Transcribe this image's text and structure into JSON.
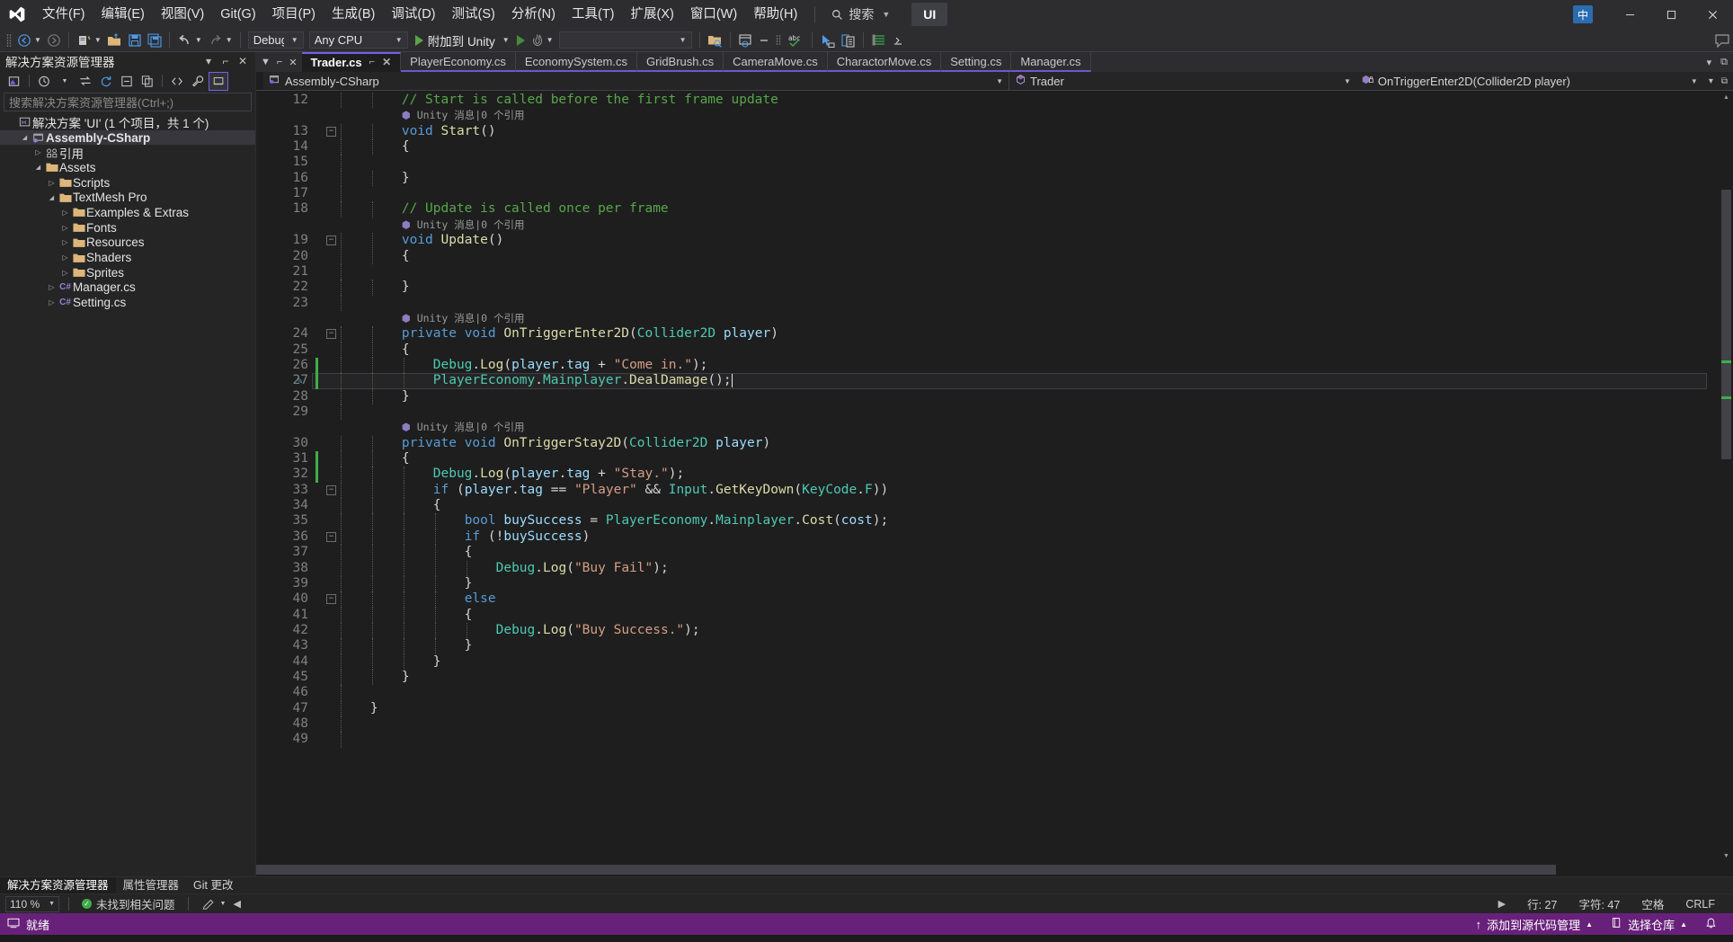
{
  "titlebar": {
    "menus": [
      {
        "label": "文件(F)"
      },
      {
        "label": "编辑(E)"
      },
      {
        "label": "视图(V)"
      },
      {
        "label": "Git(G)"
      },
      {
        "label": "项目(P)"
      },
      {
        "label": "生成(B)"
      },
      {
        "label": "调试(D)"
      },
      {
        "label": "测试(S)"
      },
      {
        "label": "分析(N)"
      },
      {
        "label": "工具(T)"
      },
      {
        "label": "扩展(X)"
      },
      {
        "label": "窗口(W)"
      },
      {
        "label": "帮助(H)"
      }
    ],
    "search_label": "搜索",
    "project_chip": "UI",
    "lang_badge": "中",
    "minimize": "—",
    "maximize": "□",
    "close": "✕"
  },
  "toolbar": {
    "config": "Debug",
    "platform": "Any CPU",
    "run_label": "附加到 Unity",
    "target_combo": ""
  },
  "solution_explorer": {
    "title": "解决方案资源管理器",
    "search_placeholder": "搜索解决方案资源管理器(Ctrl+;)",
    "pin": "⌐",
    "close": "✕",
    "dropdown": "▾",
    "tree": [
      {
        "label": "解决方案 'UI' (1 个项目，共 1 个)",
        "depth": 0,
        "icon": "solution",
        "twist": "",
        "bold": false
      },
      {
        "label": "Assembly-CSharp",
        "depth": 1,
        "icon": "project",
        "twist": "▾",
        "bold": true,
        "selected": true
      },
      {
        "label": "引用",
        "depth": 2,
        "icon": "references",
        "twist": "▸",
        "bold": false
      },
      {
        "label": "Assets",
        "depth": 2,
        "icon": "folder",
        "twist": "▾",
        "bold": false
      },
      {
        "label": "Scripts",
        "depth": 3,
        "icon": "folder",
        "twist": "▸",
        "bold": false
      },
      {
        "label": "TextMesh Pro",
        "depth": 3,
        "icon": "folder",
        "twist": "▾",
        "bold": false
      },
      {
        "label": "Examples & Extras",
        "depth": 4,
        "icon": "folder",
        "twist": "▸",
        "bold": false
      },
      {
        "label": "Fonts",
        "depth": 4,
        "icon": "folder",
        "twist": "▸",
        "bold": false
      },
      {
        "label": "Resources",
        "depth": 4,
        "icon": "folder",
        "twist": "▸",
        "bold": false
      },
      {
        "label": "Shaders",
        "depth": 4,
        "icon": "folder",
        "twist": "▸",
        "bold": false
      },
      {
        "label": "Sprites",
        "depth": 4,
        "icon": "folder",
        "twist": "▸",
        "bold": false
      },
      {
        "label": "Manager.cs",
        "depth": 3,
        "icon": "cs",
        "twist": "▸",
        "bold": false
      },
      {
        "label": "Setting.cs",
        "depth": 3,
        "icon": "cs",
        "twist": "▸",
        "bold": false
      }
    ]
  },
  "editor": {
    "tabs": [
      {
        "label": "Trader.cs",
        "active": true
      },
      {
        "label": "PlayerEconomy.cs",
        "active": false
      },
      {
        "label": "EconomySystem.cs",
        "active": false
      },
      {
        "label": "GridBrush.cs",
        "active": false
      },
      {
        "label": "CameraMove.cs",
        "active": false
      },
      {
        "label": "CharactorMove.cs",
        "active": false
      },
      {
        "label": "Setting.cs",
        "active": false
      },
      {
        "label": "Manager.cs",
        "active": false
      }
    ],
    "nav_project": "Assembly-CSharp",
    "nav_type": "Trader",
    "nav_member": "OnTriggerEnter2D(Collider2D player)",
    "first_line": 12,
    "lines": [
      {
        "n": 12,
        "lens": null,
        "fold": false,
        "change": false,
        "text": "        // Start is called before the first frame update",
        "kind": "comment"
      },
      {
        "n": null,
        "lens": "Unity 消息|0 个引用",
        "lensIndent": "        "
      },
      {
        "n": 13,
        "fold": true,
        "text": "        void Start()"
      },
      {
        "n": 14,
        "text": "        {"
      },
      {
        "n": 15,
        "text": ""
      },
      {
        "n": 16,
        "text": "        }"
      },
      {
        "n": 17,
        "text": ""
      },
      {
        "n": 18,
        "text": "        // Update is called once per frame",
        "kind": "comment"
      },
      {
        "n": null,
        "lens": "Unity 消息|0 个引用",
        "lensIndent": "        "
      },
      {
        "n": 19,
        "fold": true,
        "text": "        void Update()"
      },
      {
        "n": 20,
        "text": "        {"
      },
      {
        "n": 21,
        "text": ""
      },
      {
        "n": 22,
        "text": "        }"
      },
      {
        "n": 23,
        "text": ""
      },
      {
        "n": null,
        "lens": "Unity 消息|0 个引用",
        "lensIndent": "        "
      },
      {
        "n": 24,
        "fold": true,
        "text": "        private void OnTriggerEnter2D(Collider2D player)"
      },
      {
        "n": 25,
        "text": "        {"
      },
      {
        "n": 26,
        "change": true,
        "text": "            Debug.Log(player.tag + \"Come in.\");"
      },
      {
        "n": 27,
        "change": true,
        "current": true,
        "bookmark": true,
        "text": "            PlayerEconomy.Mainplayer.DealDamage();"
      },
      {
        "n": 28,
        "text": "        }"
      },
      {
        "n": 29,
        "text": ""
      },
      {
        "n": null,
        "lens": "Unity 消息|0 个引用",
        "lensIndent": "        "
      },
      {
        "n": 30,
        "fold": false,
        "text": "        private void OnTriggerStay2D(Collider2D player)"
      },
      {
        "n": 31,
        "change": true,
        "text": "        {"
      },
      {
        "n": 32,
        "change": true,
        "text": "            Debug.Log(player.tag + \"Stay.\");"
      },
      {
        "n": 33,
        "fold": true,
        "text": "            if (player.tag == \"Player\" && Input.GetKeyDown(KeyCode.F))"
      },
      {
        "n": 34,
        "text": "            {"
      },
      {
        "n": 35,
        "text": "                bool buySuccess = PlayerEconomy.Mainplayer.Cost(cost);"
      },
      {
        "n": 36,
        "fold": true,
        "text": "                if (!buySuccess)"
      },
      {
        "n": 37,
        "text": "                {"
      },
      {
        "n": 38,
        "text": "                    Debug.Log(\"Buy Fail\");"
      },
      {
        "n": 39,
        "text": "                }"
      },
      {
        "n": 40,
        "fold": true,
        "text": "                else"
      },
      {
        "n": 41,
        "text": "                {"
      },
      {
        "n": 42,
        "text": "                    Debug.Log(\"Buy Success.\");"
      },
      {
        "n": 43,
        "text": "                }"
      },
      {
        "n": 44,
        "text": "            }"
      },
      {
        "n": 45,
        "text": "        }"
      },
      {
        "n": 46,
        "text": ""
      },
      {
        "n": 47,
        "text": "    }"
      },
      {
        "n": 48,
        "text": ""
      },
      {
        "n": 49,
        "text": ""
      }
    ]
  },
  "dock_tabs": [
    {
      "label": "解决方案资源管理器",
      "active": true
    },
    {
      "label": "属性管理器",
      "active": false
    },
    {
      "label": "Git 更改",
      "active": false
    }
  ],
  "editor_status": {
    "zoom": "110 %",
    "issues": "未找到相关问题",
    "line": "行: 27",
    "col": "字符: 47",
    "insert_mode": "空格",
    "eol": "CRLF"
  },
  "statusbar": {
    "state": "就绪",
    "source_control": "添加到源代码管理",
    "repo": "选择仓库",
    "bell": "🔔"
  },
  "colors": {
    "accent_purple": "#68217a",
    "tab_accent": "#7160e8",
    "comment_green": "#57a64a",
    "keyword_blue": "#569cd6",
    "type_teal": "#4ec9b0",
    "string_orange": "#d69d85"
  }
}
